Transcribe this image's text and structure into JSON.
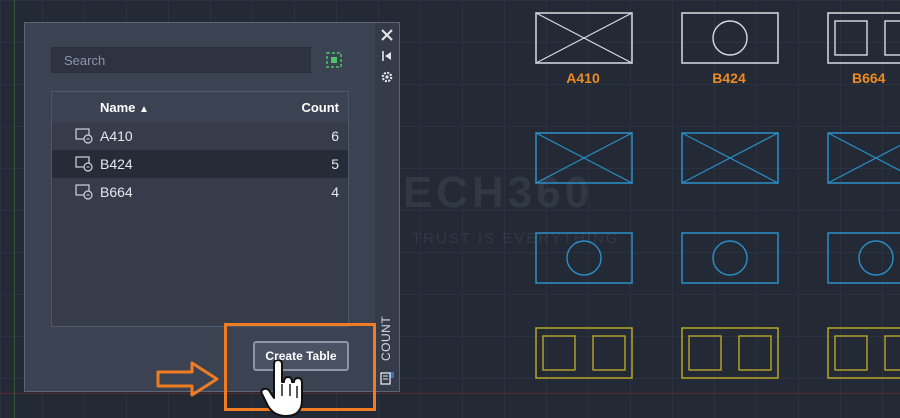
{
  "palette": {
    "search_placeholder": "Search",
    "columns": {
      "name": "Name",
      "count": "Count"
    },
    "rows": [
      {
        "name": "A410",
        "count": "6",
        "selected": false
      },
      {
        "name": "B424",
        "count": "5",
        "selected": true
      },
      {
        "name": "B664",
        "count": "4",
        "selected": false
      }
    ],
    "create_table_label": "Create Table",
    "side_title": "COUNT"
  },
  "drawing": {
    "labels": [
      "A410",
      "B424",
      "B664"
    ]
  },
  "watermark": {
    "name": "TECH360",
    "tagline": "TRUST IS EVERYTHING"
  },
  "colors": {
    "background": "#232a35",
    "panel": "#3b4252",
    "label_orange": "#ee8a22",
    "block_white": "#d8dce2",
    "block_blue": "#2a8fc8",
    "block_yellow": "#b8a628",
    "annotation_orange": "#f07c22"
  }
}
